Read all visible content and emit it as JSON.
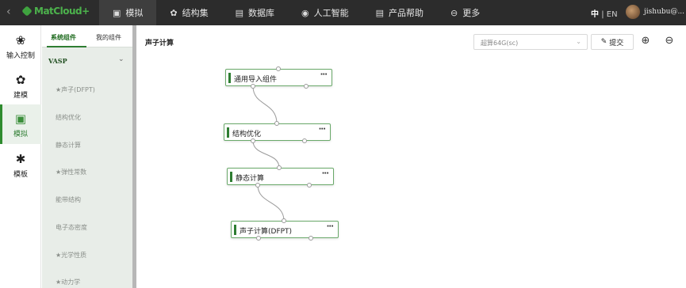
{
  "topbar": {
    "logo_text": "MatCloud+",
    "nav": [
      {
        "label": "模拟",
        "icon": "cube-icon"
      },
      {
        "label": "结构集",
        "icon": "cluster-icon"
      },
      {
        "label": "数据库",
        "icon": "database-icon"
      },
      {
        "label": "人工智能",
        "icon": "brain-icon"
      },
      {
        "label": "产品帮助",
        "icon": "book-icon"
      },
      {
        "label": "更多",
        "icon": "more-circle-icon"
      }
    ],
    "lang_zh": "中",
    "lang_sep": "|",
    "lang_en": "EN",
    "username": "jishubu@..."
  },
  "leftnav": [
    {
      "label": "输入控制",
      "icon": "flower-icon"
    },
    {
      "label": "建模",
      "icon": "atoms-icon"
    },
    {
      "label": "模拟",
      "icon": "cube-icon"
    },
    {
      "label": "模板",
      "icon": "puzzle-icon"
    }
  ],
  "panel": {
    "tabs": [
      "系统组件",
      "我的组件"
    ],
    "group": "VASP",
    "items": [
      "★声子(DFPT)",
      "结构优化",
      "静态计算",
      "★弹性常数",
      "能带结构",
      "电子态密度",
      "★光学性质",
      "★动力学"
    ]
  },
  "canvas": {
    "title": "声子计算",
    "select_value": "超算64G(sc)",
    "submit_label": "提交",
    "nodes": [
      "通用导入组件",
      "结构优化",
      "静态计算",
      "声子计算(DFPT)"
    ],
    "node_menu": "···"
  },
  "colors": {
    "accent": "#2e7d32",
    "topbar": "#2c2c2c",
    "panel": "#e8ede8"
  }
}
